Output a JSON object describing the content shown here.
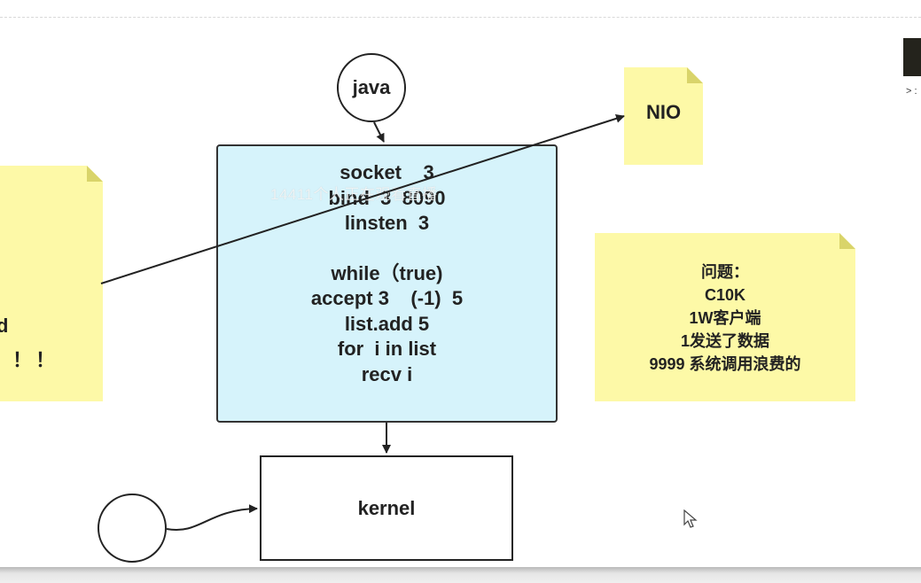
{
  "diagram": {
    "java_node": {
      "label": "java"
    },
    "main_box": {
      "lines": [
        "socket    3",
        "bind  3  8090",
        "linsten  3",
        "",
        "while（true)",
        "accept 3    (-1)  5",
        "list.add 5",
        "for  i in list",
        "recv i"
      ]
    },
    "watermark": {
      "text": "14411个人正在观看直播"
    },
    "kernel_box": {
      "label": "kernel"
    },
    "nio_note": {
      "label": "NIO"
    },
    "question_note": {
      "lines": [
        "问题：",
        "C10K",
        "1W客户端",
        "1发送了数据",
        "9999 系统调用浪费的"
      ]
    },
    "left_note": {
      "line1": "d",
      "line2": "！！！"
    },
    "side_panel": {
      "text": "> :"
    }
  },
  "colors": {
    "main_box_fill": "#d6f3fb",
    "note_fill": "#fdf9a7",
    "stroke": "#222222"
  }
}
